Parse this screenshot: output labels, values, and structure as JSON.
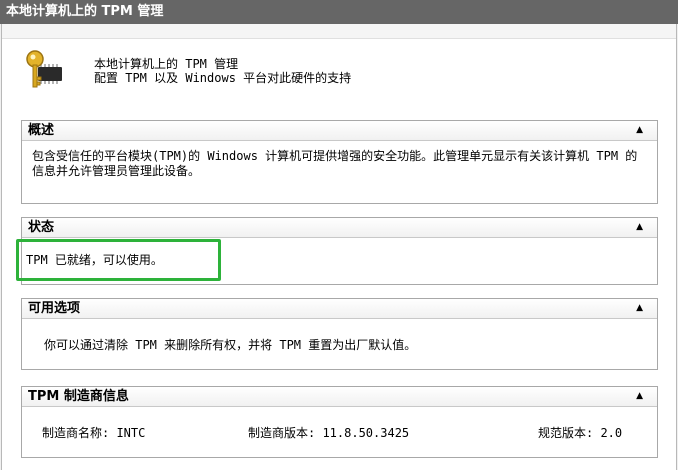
{
  "window": {
    "title": "本地计算机上的 TPM 管理"
  },
  "intro": {
    "line1": "本地计算机上的 TPM 管理",
    "line2": "配置 TPM 以及 Windows 平台对此硬件的支持",
    "icon": "key-chip-icon"
  },
  "overview": {
    "heading": "概述",
    "text": "包含受信任的平台模块(TPM)的 Windows 计算机可提供增强的安全功能。此管理单元显示有关该计算机 TPM 的信息并允许管理员管理此设备。"
  },
  "status": {
    "heading": "状态",
    "text": "TPM 已就绪，可以使用。"
  },
  "options": {
    "heading": "可用选项",
    "text": "你可以通过清除 TPM 来删除所有权，并将 TPM 重置为出厂默认值。"
  },
  "manufacturer": {
    "heading": "TPM 制造商信息",
    "name_label": "制造商名称: INTC",
    "version_label": "制造商版本: 11.8.50.3425",
    "spec_label": "规范版本: 2.0"
  },
  "colors": {
    "titlebar": "#666666",
    "highlight": "#2db23a"
  }
}
